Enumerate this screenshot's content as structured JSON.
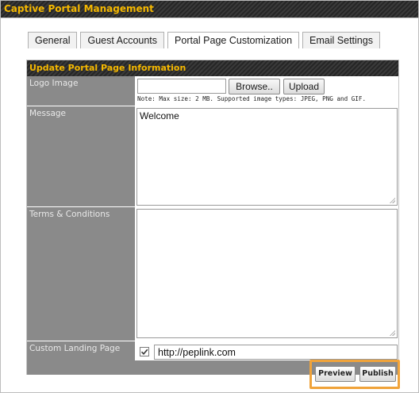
{
  "window": {
    "title": "Captive Portal Management"
  },
  "tabs": [
    {
      "label": "General",
      "active": false
    },
    {
      "label": "Guest Accounts",
      "active": false
    },
    {
      "label": "Portal Page Customization",
      "active": true
    },
    {
      "label": "Email Settings",
      "active": false
    }
  ],
  "panel": {
    "title": "Update Portal Page Information",
    "logo": {
      "label": "Logo Image",
      "browse_label": "Browse..",
      "upload_label": "Upload",
      "note": "Note: Max size: 2 MB. Supported image types: JPEG, PNG and GIF."
    },
    "message": {
      "label": "Message",
      "value": "Welcome"
    },
    "terms": {
      "label": "Terms & Conditions",
      "value": ""
    },
    "landing": {
      "label": "Custom Landing Page",
      "checked": true,
      "url": "http://peplink.com"
    }
  },
  "actions": {
    "preview_label": "Preview",
    "publish_label": "Publish"
  },
  "colors": {
    "title_text": "#f5b800",
    "label_bg": "#8a8a8a",
    "highlight": "#f0a33a"
  }
}
